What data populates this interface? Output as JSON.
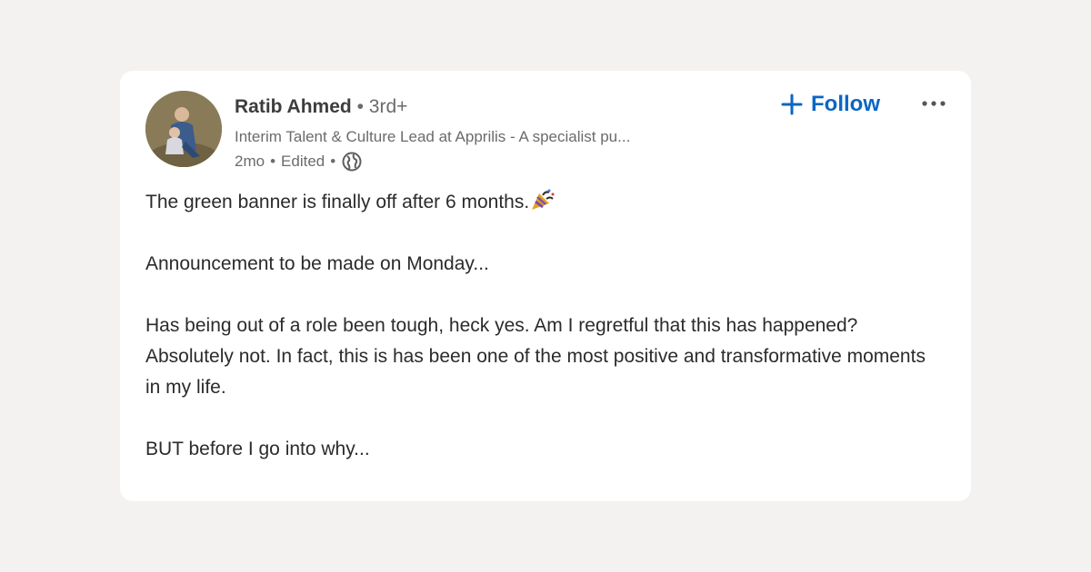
{
  "author": {
    "name": "Ratib Ahmed",
    "degree": "3rd+",
    "degree_separator": "•",
    "headline": "Interim Talent & Culture Lead at Apprilis - A specialist pu...",
    "time": "2mo",
    "edited": "Edited",
    "meta_separator": "•",
    "visibility_icon": "globe-icon"
  },
  "actions": {
    "follow_label": "Follow",
    "follow_icon": "plus-icon",
    "more_icon": "more-horizontal-icon"
  },
  "post": {
    "paragraphs": [
      "The green banner is finally off after 6 months.",
      "Announcement to be made on Monday...",
      "Has being out of a role been tough, heck yes. Am I regretful that this has happened? Absolutely not. In fact, this is has been one of the most positive and transformative moments in my life.",
      "BUT before I go into why..."
    ],
    "emoji_icon": "party-popper-icon"
  },
  "colors": {
    "accent": "#0a66c2",
    "page_background": "#f3f2f0",
    "card_background": "#ffffff"
  }
}
